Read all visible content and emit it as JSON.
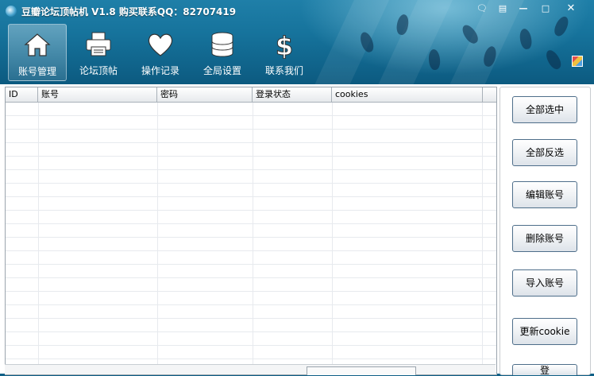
{
  "window": {
    "title": "豆瓣论坛顶帖机 V1.8 购买联系QQ：82707419",
    "controls": [
      "feedback-icon",
      "menu-icon",
      "minimize-icon",
      "maximize-icon",
      "close-icon"
    ]
  },
  "toolbar": {
    "items": [
      {
        "label": "账号管理",
        "icon": "home-icon",
        "active": true
      },
      {
        "label": "论坛顶帖",
        "icon": "printer-icon",
        "active": false
      },
      {
        "label": "操作记录",
        "icon": "heart-icon",
        "active": false
      },
      {
        "label": "全局设置",
        "icon": "database-icon",
        "active": false
      },
      {
        "label": "联系我们",
        "icon": "dollar-icon",
        "active": false
      }
    ],
    "skin_icon": "skin-icon"
  },
  "grid": {
    "columns": [
      "ID",
      "账号",
      "密码",
      "登录状态",
      "cookies"
    ],
    "rows": []
  },
  "side_buttons": {
    "select_all": "全部选中",
    "invert_selection": "全部反选",
    "edit_account": "编辑账号",
    "delete_account": "删除账号",
    "import_account": "导入账号",
    "refresh_cookie": "更新cookie",
    "partial_next": "登"
  },
  "colors": {
    "header_bg": "#16739c",
    "button_border": "#4e6e8a",
    "grid_line": "#e7eaee"
  }
}
